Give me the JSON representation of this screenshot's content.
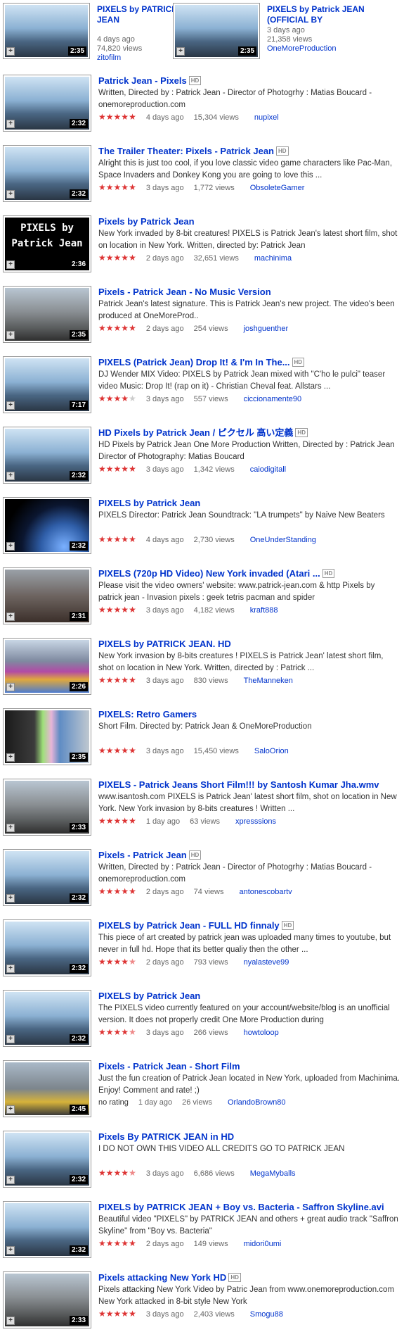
{
  "top": [
    {
      "title": "PIXELS by PATRICK JEAN",
      "age": "4 days ago",
      "views": "74,820 views",
      "user": "zitofilm",
      "duration": "2:35",
      "style": "t-sky"
    },
    {
      "title": "PIXELS by Patrick JEAN (OFFICIAL BY",
      "age": "3 days ago",
      "views": "21,358 views",
      "user": "OneMoreProduction",
      "duration": "2:35",
      "style": "t-sky"
    }
  ],
  "results": [
    {
      "title": "Patrick Jean - Pixels",
      "hd": true,
      "desc": "Written, Directed by : Patrick Jean - Director of Photogrhy : Matias Boucard - onemoreproduction.com",
      "stars": 5,
      "age": "4 days ago",
      "views": "15,304 views",
      "user": "nupixel",
      "duration": "2:32",
      "style": "t-sky"
    },
    {
      "title": "The Trailer Theater: Pixels - Patrick Jean",
      "hd": true,
      "desc": "Alright this is just too cool, if you love classic video game characters like Pac-Man, Space Invaders and Donkey Kong you are going to love this ...",
      "stars": 5,
      "age": "3 days ago",
      "views": "1,772 views",
      "user": "ObsoleteGamer",
      "duration": "2:32",
      "style": "t-sky"
    },
    {
      "title": "Pixels by Patrick Jean",
      "hd": false,
      "desc": "New York invaded by 8-bit creatures! PIXELS is Patrick Jean's latest short film, shot on location in New York. Written, directed by: Patrick Jean",
      "stars": 5,
      "age": "2 days ago",
      "views": "32,651 views",
      "user": "machinima",
      "duration": "2:36",
      "style": "t-black",
      "overlay": "PIXELS by Patrick Jean"
    },
    {
      "title": "Pixels - Patrick Jean - No Music Version",
      "hd": false,
      "desc": "Patrick Jean's latest signature. This is Patrick Jean's new project. The video's been produced at OneMoreProd..",
      "stars": 5,
      "age": "2 days ago",
      "views": "254 views",
      "user": "joshguenther",
      "duration": "2:35",
      "style": "t-street"
    },
    {
      "title": "PIXELS (Patrick Jean) Drop It! & I'm In The...",
      "hd": true,
      "desc": "DJ Wender MIX Video: PIXELS by Patrick Jean mixed with \"C'ho le pulci\" teaser video Music: Drop It! (rap on it) - Christian Cheval feat. Allstars ...",
      "stars": 4,
      "age": "3 days ago",
      "views": "557 views",
      "user": "ciccionamente90",
      "duration": "7:17",
      "style": "t-sky"
    },
    {
      "title": "HD Pixels by Patrick Jean / ピクセル 高い定義",
      "hd": true,
      "desc": "HD Pixels by Patrick Jean One More Production Written, Directed by : Patrick Jean Director of Photography: Matias Boucard",
      "stars": 5,
      "age": "3 days ago",
      "views": "1,342 views",
      "user": "caiodigitall",
      "duration": "2:32",
      "style": "t-sky"
    },
    {
      "title": "PIXELS by Patrick Jean",
      "hd": false,
      "desc": "PIXELS Director: Patrick Jean Soundtrack: \"LA trumpets\" by Naive New Beaters",
      "stars": 5,
      "age": "4 days ago",
      "views": "2,730 views",
      "user": "OneUnderStanding",
      "duration": "2:32",
      "style": "t-earth"
    },
    {
      "title": "PIXELS (720p HD Video) New York invaded (Atari ...",
      "hd": true,
      "desc": "Please visit the video owners' website: www.patrick-jean.com & http Pixels by patrick jean - Invasion pixels : geek tetris pacman and spider",
      "stars": 5,
      "age": "3 days ago",
      "views": "4,182 views",
      "user": "kraft888",
      "duration": "2:31",
      "style": "t-ruins"
    },
    {
      "title": "PIXELS by PATRICK JEAN. HD",
      "hd": false,
      "desc": "New York invasion by 8-bits creatures ! PIXELS is Patrick Jean' latest short film, shot on location in New York. Written, directed by : Patrick ...",
      "stars": 5,
      "age": "3 days ago",
      "views": "830 views",
      "user": "TheManneken",
      "duration": "2:26",
      "style": "t-color"
    },
    {
      "title": "PIXELS: Retro Gamers",
      "hd": false,
      "desc": "Short Film. Directed by: Patrick Jean & OneMoreProduction",
      "stars": 5,
      "age": "3 days ago",
      "views": "15,450 views",
      "user": "SaloOrion",
      "duration": "2:35",
      "style": "t-green"
    },
    {
      "title": "PIXELS - Patrick Jeans Short Film!!! by Santosh Kumar Jha.wmv",
      "hd": false,
      "desc": "www.isantosh.com PIXELS is Patrick Jean' latest short film, shot on location in New York. New York invasion by 8-bits creatures ! Written ...",
      "stars": 5,
      "age": "1 day ago",
      "views": "63 views",
      "user": "xpresssions",
      "duration": "2:33",
      "style": "t-street"
    },
    {
      "title": "Pixels - Patrick Jean",
      "hd": true,
      "desc": "Written, Directed by : Patrick Jean - Director of Photogrhy : Matias Boucard - onemoreproduction.com",
      "stars": 5,
      "age": "2 days ago",
      "views": "74 views",
      "user": "antonescobartv",
      "duration": "2:32",
      "style": "t-sky"
    },
    {
      "title": "PIXELS by Patrick Jean - FULL HD finnaly",
      "hd": true,
      "desc": "This piece of art created by patrick jean was uploaded many times to youtube, but never in full hd. Hope that its better qualiy then the other ...",
      "stars": 4.5,
      "age": "2 days ago",
      "views": "793 views",
      "user": "nyalasteve99",
      "duration": "2:32",
      "style": "t-sky"
    },
    {
      "title": "PIXELS by Patrick Jean",
      "hd": false,
      "desc": "The PIXELS video currently featured on your account/website/blog is an unofficial version. It does not properly credit One More Production during",
      "stars": 4.5,
      "age": "3 days ago",
      "views": "266 views",
      "user": "howtoloop",
      "duration": "2:32",
      "style": "t-sky"
    },
    {
      "title": "Pixels - Patrick Jean - Short Film",
      "hd": false,
      "desc": "Just the fun creation of Patrick Jean located in New York, uploaded from Machinima. Enjoy! Comment and rate! ;)",
      "stars": 0,
      "rating_text": "no rating",
      "age": "1 day ago",
      "views": "26 views",
      "user": "OrlandoBrown80",
      "duration": "2:45",
      "style": "t-taxi"
    },
    {
      "title": "Pixels By PATRICK JEAN in HD",
      "hd": false,
      "desc": "I DO NOT OWN THIS VIDEO ALL CREDITS GO TO PATRICK JEAN",
      "stars": 4.5,
      "age": "3 days ago",
      "views": "6,686 views",
      "user": "MegaMyballs",
      "duration": "2:32",
      "style": "t-sky"
    },
    {
      "title": "PIXELS by PATRICK JEAN + Boy vs. Bacteria - Saffron Skyline.avi",
      "hd": false,
      "desc": "Beautiful video \"PIXELS\" by PATRICK JEAN and others + great audio track \"Saffron Skyline\" from \"Boy vs. Bacteria\"",
      "stars": 5,
      "age": "2 days ago",
      "views": "149 views",
      "user": "midori0umi",
      "duration": "2:32",
      "style": "t-sky"
    },
    {
      "title": "Pixels attacking New York HD",
      "hd": true,
      "desc": "Pixels attacking New York Video by Patric Jean from www.onemoreproduction.com New York attacked in 8-bit style New York",
      "stars": 5,
      "age": "3 days ago",
      "views": "2,403 views",
      "user": "Smogu88",
      "duration": "2:33",
      "style": "t-street"
    }
  ],
  "labels": {
    "hd_badge": "HD",
    "add_glyph": "+",
    "star_glyph": "★"
  },
  "colors": {
    "link": "#0033cc",
    "star": "#dd3333",
    "duration_bg": "#000000"
  }
}
